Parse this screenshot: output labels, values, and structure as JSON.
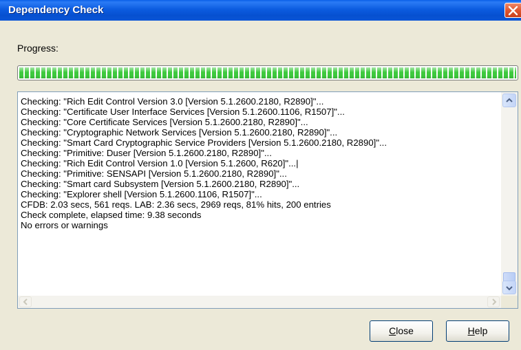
{
  "window": {
    "title": "Dependency Check"
  },
  "progress": {
    "label": "Progress:",
    "percent": 100
  },
  "log": {
    "lines": [
      "Checking: \"Rich Edit Control Version 3.0 [Version 5.1.2600.2180, R2890]\"...",
      "Checking: \"Certificate User Interface Services [Version 5.1.2600.1106, R1507]\"...",
      "Checking: \"Core Certificate Services [Version 5.1.2600.2180, R2890]\"...",
      "Checking: \"Cryptographic Network Services [Version 5.1.2600.2180, R2890]\"...",
      "Checking: \"Smart Card Cryptographic Service Providers [Version 5.1.2600.2180, R2890]\"...",
      "Checking: \"Primitive: Duser [Version 5.1.2600.2180, R2890]\"...",
      "Checking: \"Rich Edit Control Version 1.0 [Version 5.1.2600, R620]\"...|",
      "Checking: \"Primitive: SENSAPI [Version 5.1.2600.2180, R2890]\"...",
      "Checking: \"Smart card Subsystem [Version 5.1.2600.2180, R2890]\"...",
      "Checking: \"Explorer shell [Version 5.1.2600.1106, R1507]\"...",
      "CFDB: 2.03 secs, 561 reqs. LAB: 2.36 secs, 2969 reqs, 81% hits, 200 entries",
      "Check complete, elapsed time: 9.38 seconds",
      "No errors or warnings"
    ]
  },
  "buttons": {
    "close_mnemonic": "C",
    "close_rest": "lose",
    "help_mnemonic": "H",
    "help_rest": "elp"
  },
  "icons": {
    "close": "close-icon",
    "scroll_up": "scroll-up-arrow-icon",
    "scroll_down": "scroll-down-arrow-icon",
    "scroll_left": "scroll-left-arrow-icon",
    "scroll_right": "scroll-right-arrow-icon"
  },
  "colors": {
    "titlebar": "#0a55d6",
    "progress": "#3ec93e",
    "close_button": "#e0562f"
  }
}
